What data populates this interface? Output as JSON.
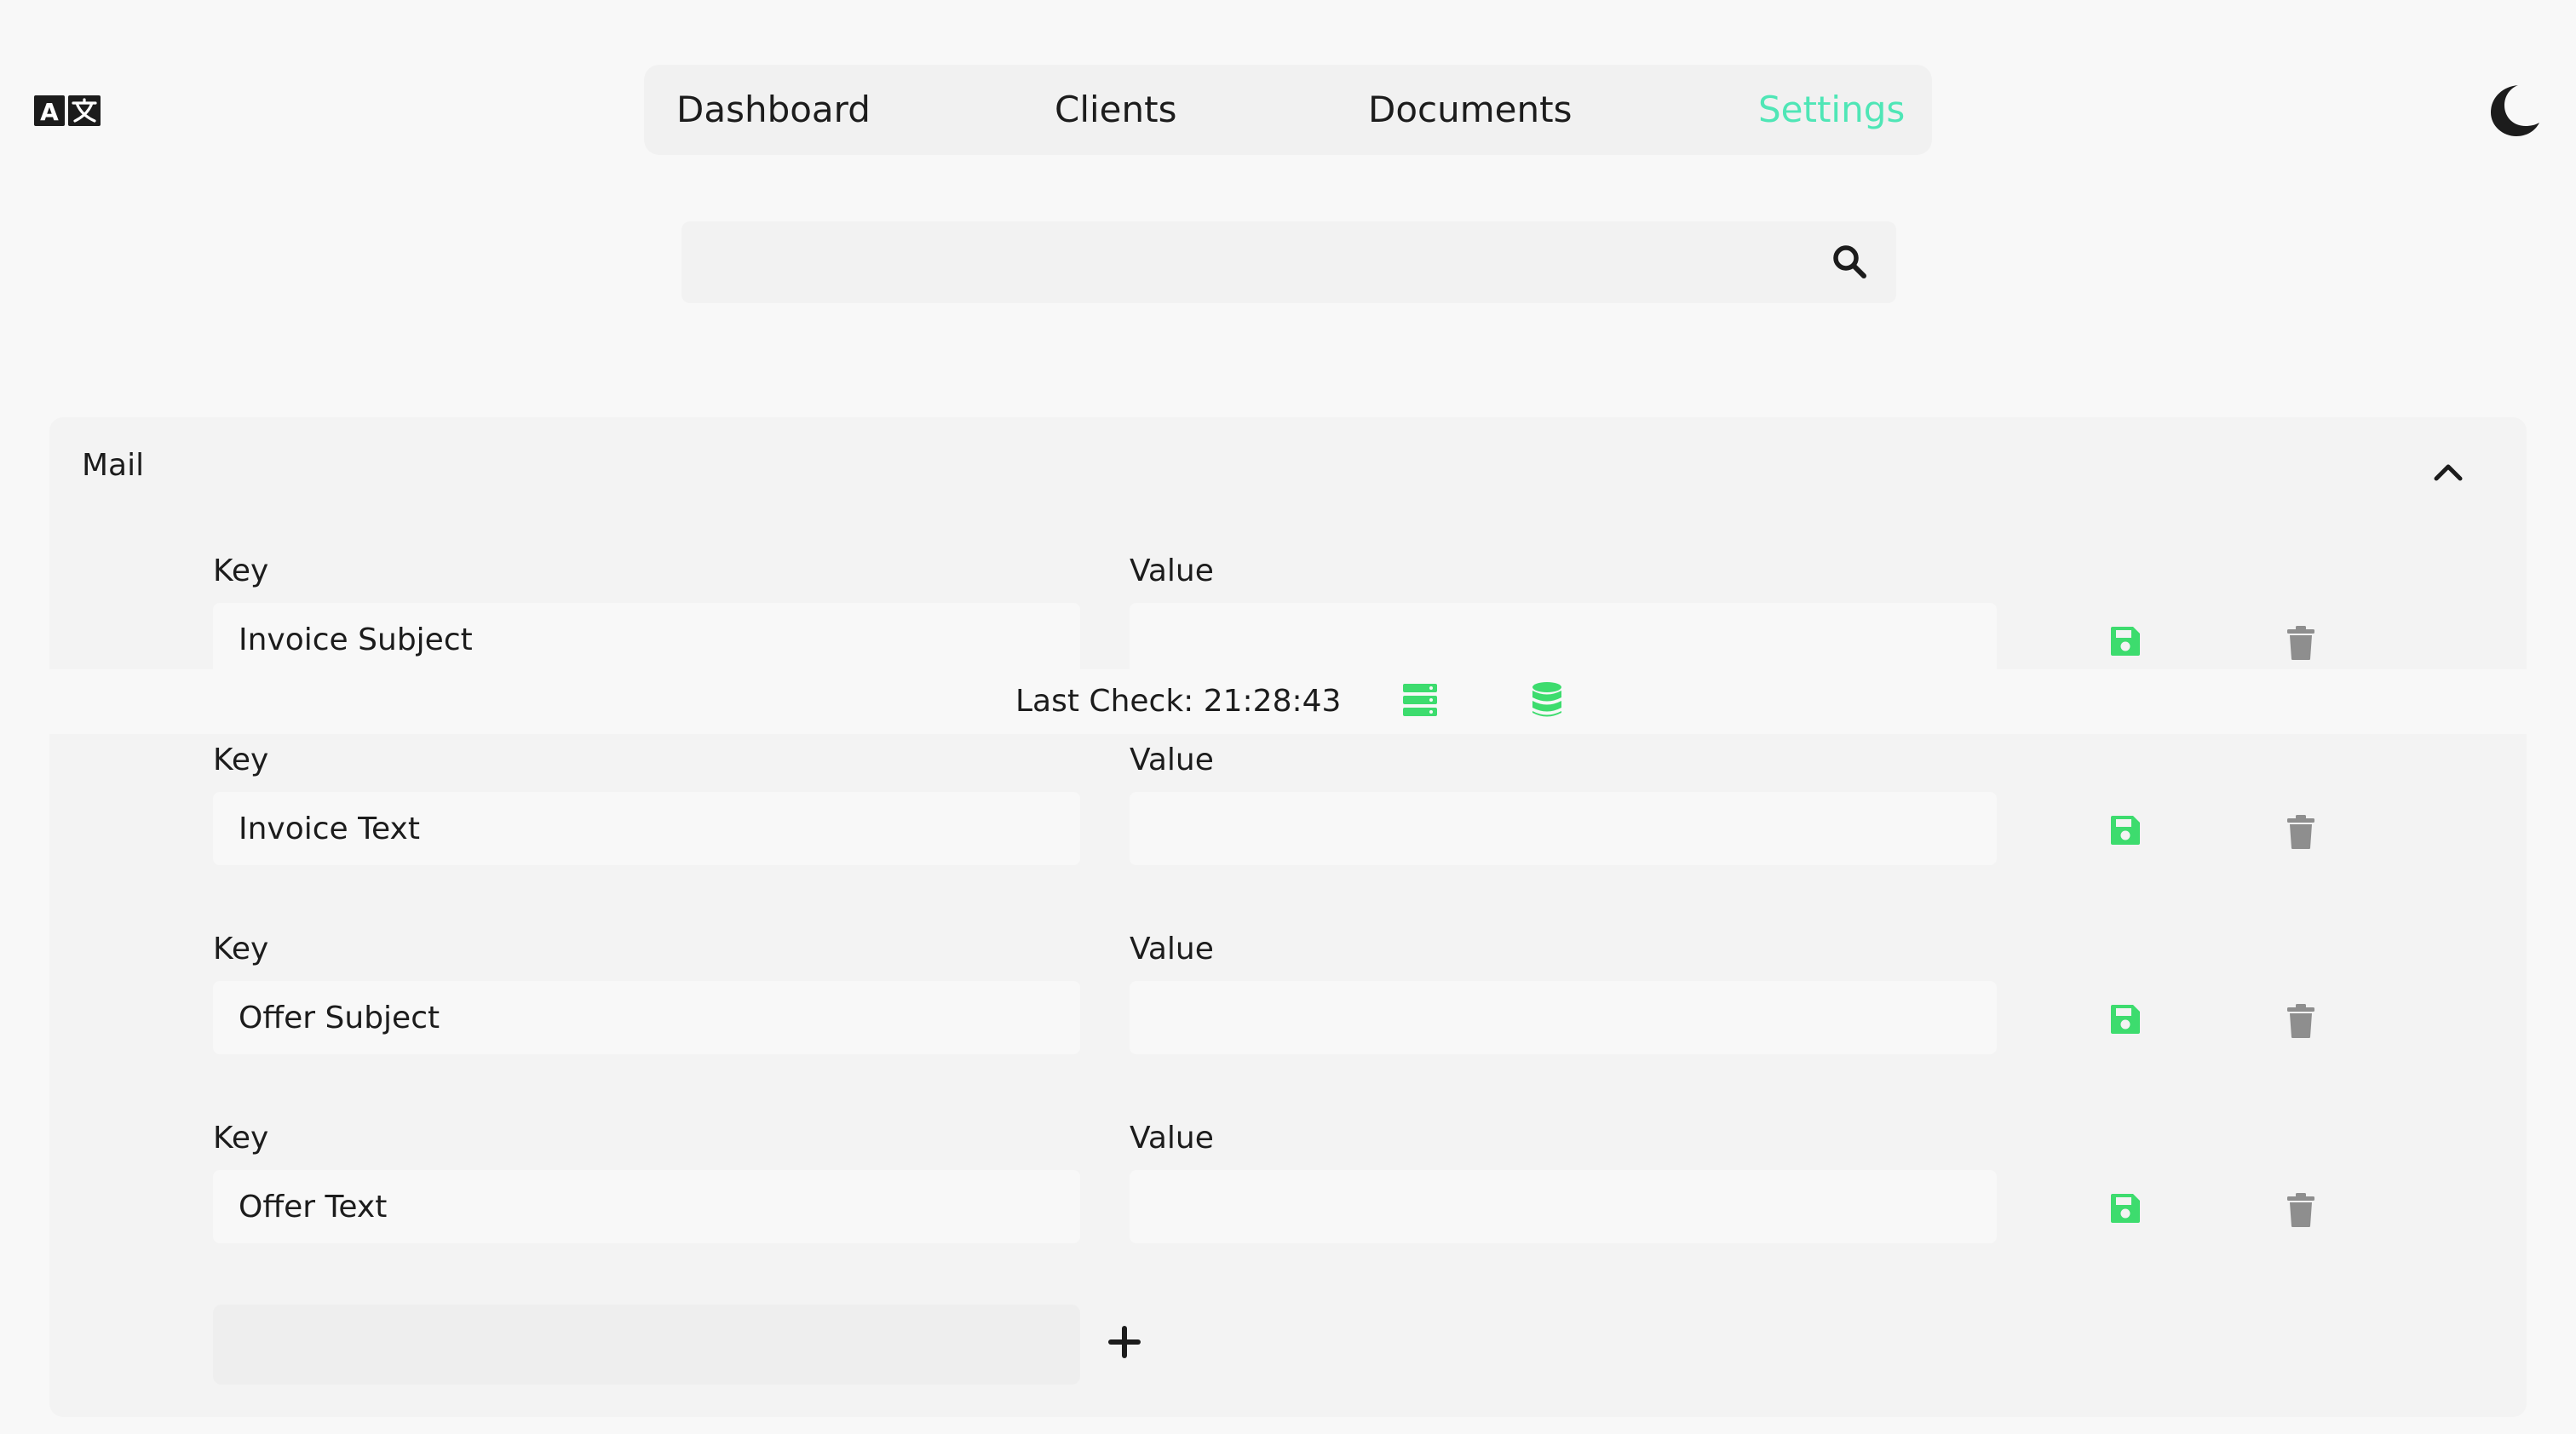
{
  "nav": {
    "items": [
      {
        "label": "Dashboard",
        "active": false
      },
      {
        "label": "Clients",
        "active": false
      },
      {
        "label": "Documents",
        "active": false
      },
      {
        "label": "Settings",
        "active": true
      }
    ]
  },
  "header": {
    "language_icon": "translate-icon",
    "theme_icon": "moon-icon"
  },
  "search": {
    "value": "",
    "placeholder": "",
    "icon": "search-icon"
  },
  "section": {
    "title": "Mail",
    "collapse_icon": "chevron-up-icon",
    "rows": [
      {
        "key_label": "Key",
        "value_label": "Value",
        "key": "Invoice Subject",
        "value": ""
      },
      {
        "key_label": "Key",
        "value_label": "Value",
        "key": "Invoice Text",
        "value": ""
      },
      {
        "key_label": "Key",
        "value_label": "Value",
        "key": "Offer Subject",
        "value": ""
      },
      {
        "key_label": "Key",
        "value_label": "Value",
        "key": "Offer Text",
        "value": ""
      }
    ],
    "add_icon": "plus-icon"
  },
  "status": {
    "last_check": "Last Check: 21:28:43",
    "server_icon": "server-icon",
    "database_icon": "database-icon"
  },
  "colors": {
    "accent": "#4fe6b6",
    "save_green": "#3ddc6e",
    "trash_gray": "#8e8e8e",
    "text": "#1c1c1c",
    "background": "#f8f8f8",
    "panel": "#f3f3f3"
  }
}
